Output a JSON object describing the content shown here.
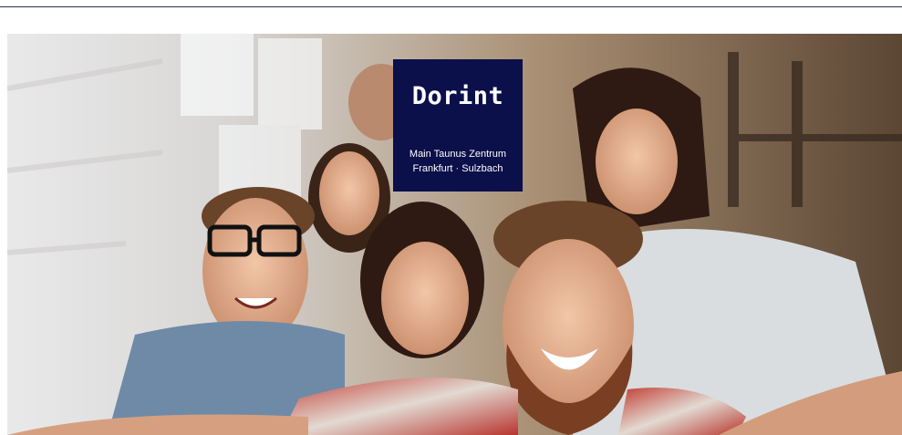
{
  "logo": {
    "brand": "Dorint",
    "line1": "Main Taunus Zentrum",
    "line2": "Frankfurt · Sulzbach"
  },
  "colors": {
    "rule": "#2c2f55",
    "logo_bg": "#0b0f4a",
    "logo_text": "#ffffff"
  }
}
